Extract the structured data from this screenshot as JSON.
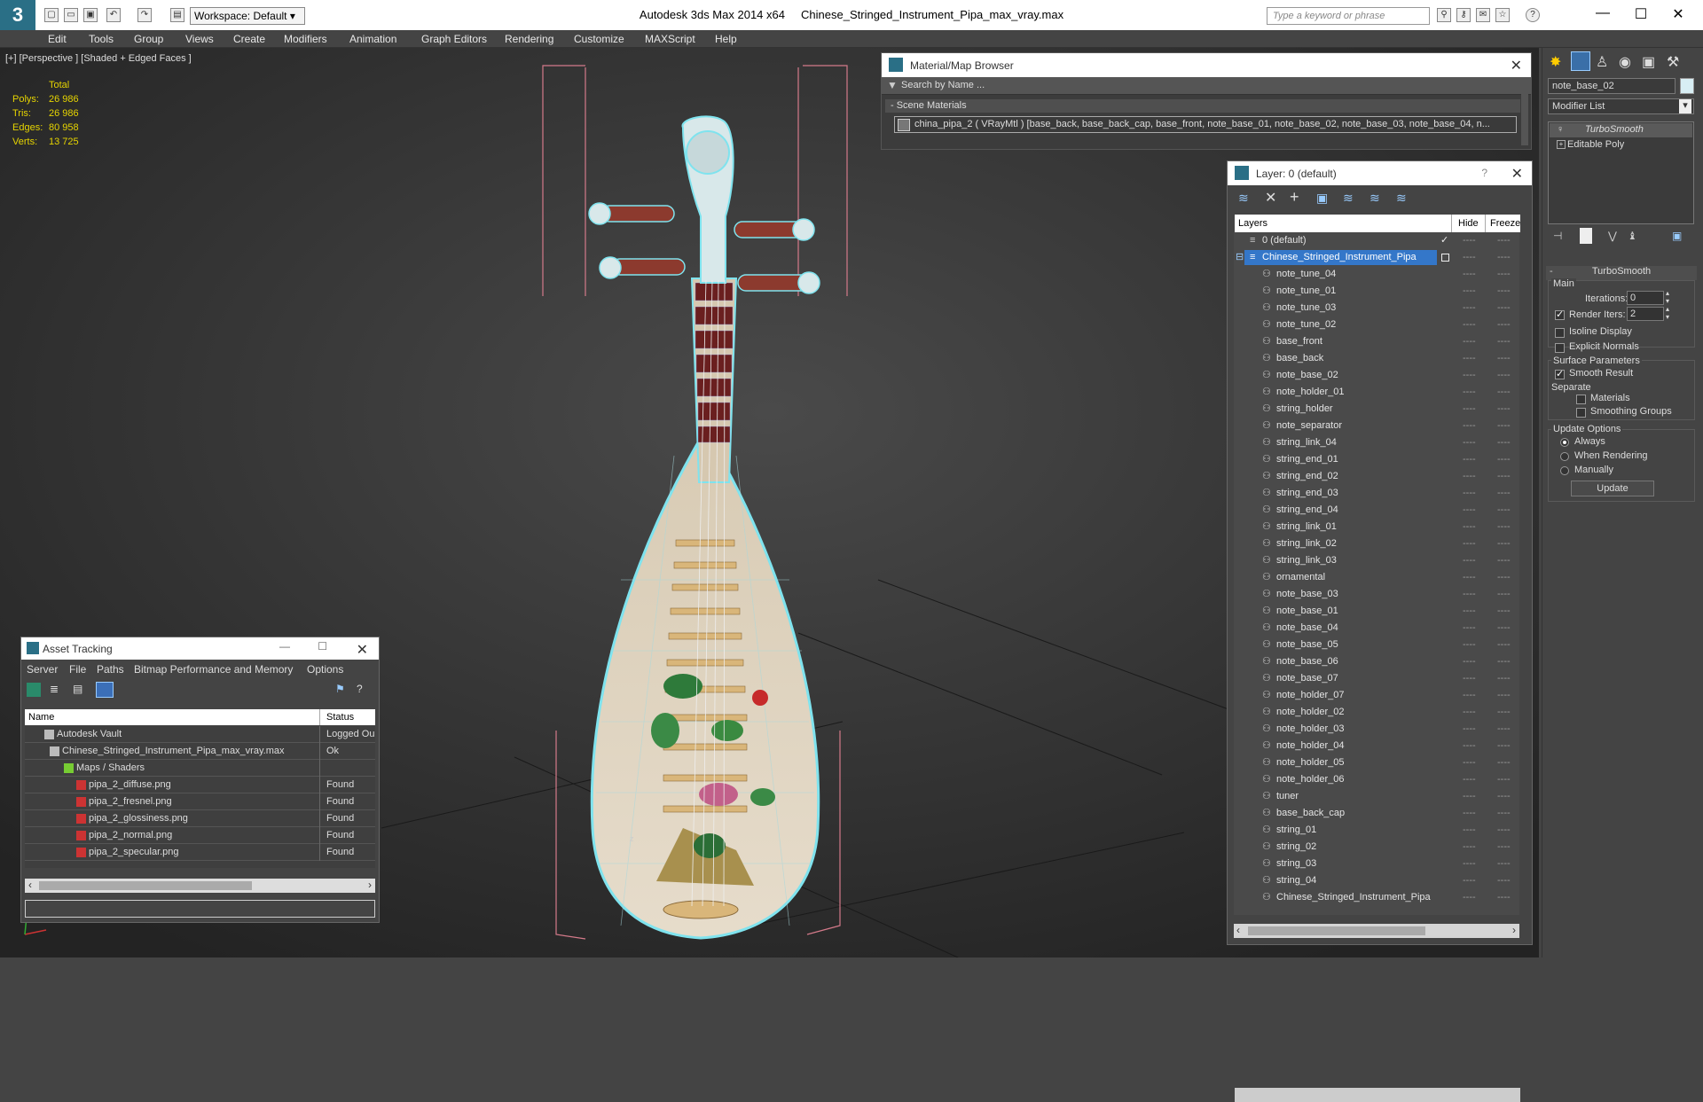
{
  "titlebar": {
    "app": "Autodesk 3ds Max  2014 x64",
    "file": "Chinese_Stringed_Instrument_Pipa_max_vray.max",
    "workspace": "Workspace: Default",
    "search_placeholder": "Type a keyword or phrase"
  },
  "menu": [
    "Edit",
    "Tools",
    "Group",
    "Views",
    "Create",
    "Modifiers",
    "Animation",
    "Graph Editors",
    "Rendering",
    "Customize",
    "MAXScript",
    "Help"
  ],
  "viewport": {
    "label": "[+] [Perspective ] [Shaded + Edged Faces ]",
    "stats": {
      "header": "Total",
      "polys_label": "Polys:",
      "polys": "26 986",
      "tris_label": "Tris:",
      "tris": "26 986",
      "edges_label": "Edges:",
      "edges": "80 958",
      "verts_label": "Verts:",
      "verts": "13 725"
    }
  },
  "material_browser": {
    "title": "Material/Map Browser",
    "search": "Search by Name ...",
    "section": "- Scene Materials",
    "material": "china_pipa_2  ( VRayMtl ) [base_back, base_back_cap, base_front, note_base_01, note_base_02, note_base_03, note_base_04, n..."
  },
  "layers": {
    "title": "Layer: 0 (default)",
    "col_layers": "Layers",
    "col_hide": "Hide",
    "col_freeze": "Freeze",
    "default_layer": "0 (default)",
    "selected_layer": "Chinese_Stringed_Instrument_Pipa",
    "items": [
      "note_tune_04",
      "note_tune_01",
      "note_tune_03",
      "note_tune_02",
      "base_front",
      "base_back",
      "note_base_02",
      "note_holder_01",
      "string_holder",
      "note_separator",
      "string_link_04",
      "string_end_01",
      "string_end_02",
      "string_end_03",
      "string_end_04",
      "string_link_01",
      "string_link_02",
      "string_link_03",
      "ornamental",
      "note_base_03",
      "note_base_01",
      "note_base_04",
      "note_base_05",
      "note_base_06",
      "note_base_07",
      "note_holder_07",
      "note_holder_02",
      "note_holder_03",
      "note_holder_04",
      "note_holder_05",
      "note_holder_06",
      "tuner",
      "base_back_cap",
      "string_01",
      "string_02",
      "string_03",
      "string_04",
      "Chinese_Stringed_Instrument_Pipa"
    ],
    "dash": "----"
  },
  "asset_tracking": {
    "title": "Asset Tracking",
    "menu": [
      "Server",
      "File",
      "Paths",
      "Bitmap Performance and Memory",
      "Options"
    ],
    "col_name": "Name",
    "col_status": "Status",
    "rows": [
      {
        "name": "Autodesk Vault",
        "status": "Logged Ou"
      },
      {
        "name": "Chinese_Stringed_Instrument_Pipa_max_vray.max",
        "status": "Ok"
      },
      {
        "name": "Maps / Shaders",
        "status": ""
      },
      {
        "name": "pipa_2_diffuse.png",
        "status": "Found"
      },
      {
        "name": "pipa_2_fresnel.png",
        "status": "Found"
      },
      {
        "name": "pipa_2_glossiness.png",
        "status": "Found"
      },
      {
        "name": "pipa_2_normal.png",
        "status": "Found"
      },
      {
        "name": "pipa_2_specular.png",
        "status": "Found"
      }
    ]
  },
  "command_panel": {
    "object_name": "note_base_02",
    "modifier_list": "Modifier List",
    "stack": [
      "TurboSmooth",
      "Editable Poly"
    ],
    "rollout": "TurboSmooth",
    "main": "Main",
    "iterations_label": "Iterations:",
    "iterations": "0",
    "render_iters_label": "Render Iters:",
    "render_iters": "2",
    "isoline": "Isoline Display",
    "explicit": "Explicit Normals",
    "surface": "Surface Parameters",
    "smooth_result": "Smooth Result",
    "separate": "Separate",
    "materials": "Materials",
    "smoothing_groups": "Smoothing Groups",
    "update_options": "Update Options",
    "always": "Always",
    "when_rendering": "When Rendering",
    "manually": "Manually",
    "update": "Update"
  }
}
